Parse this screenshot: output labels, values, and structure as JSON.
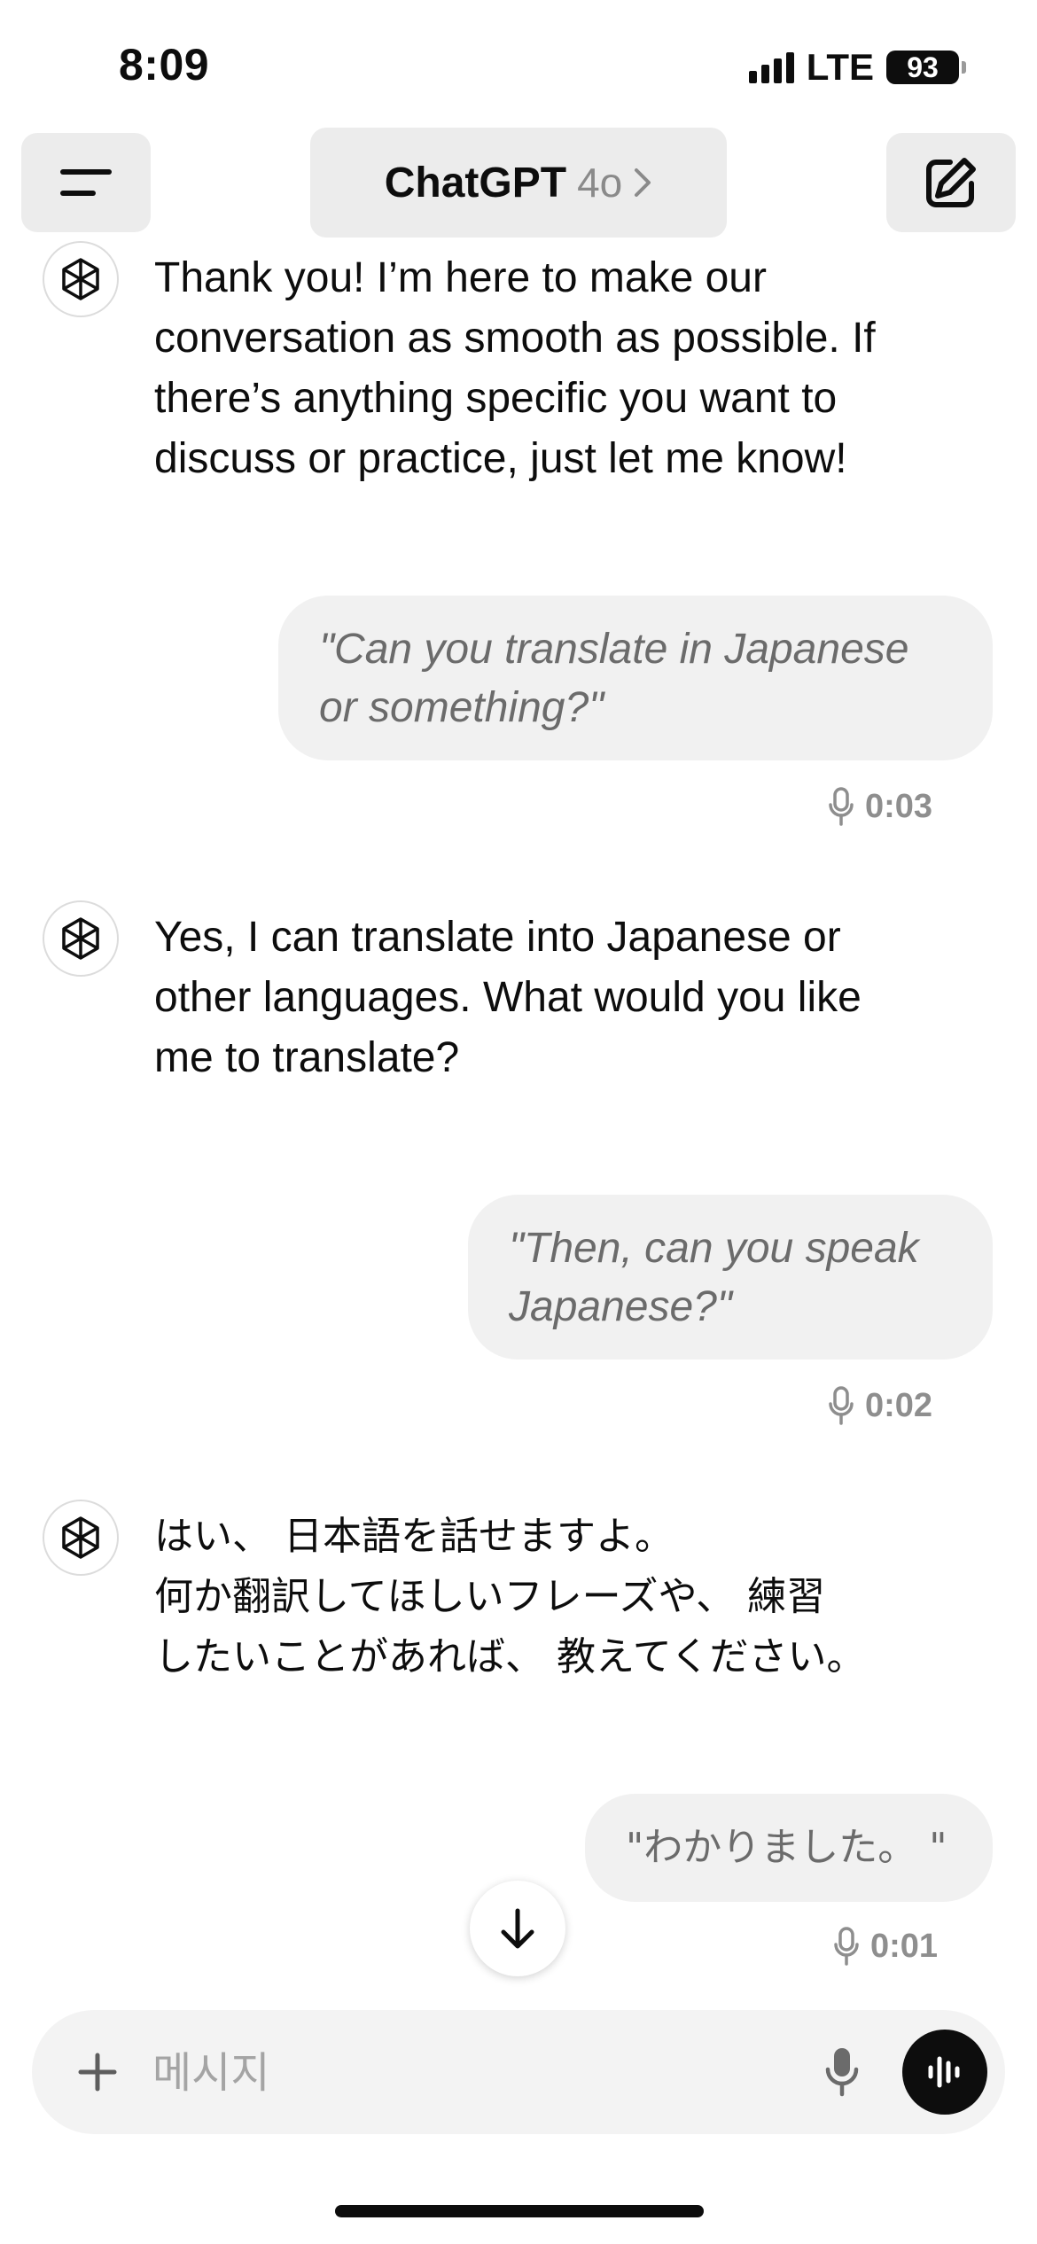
{
  "status_bar": {
    "time": "8:09",
    "network": "LTE",
    "battery": "93"
  },
  "header": {
    "title": "ChatGPT",
    "model": "4o",
    "icons": {
      "menu": "menu-icon",
      "compose": "new-chat-icon",
      "chevron": "chevron-right-icon"
    }
  },
  "messages": [
    {
      "role": "assistant",
      "text": "Thank you! I’m here to make our\nconversation as smooth as possible. If\nthere’s anything specific you want to\ndiscuss or practice, just let me know!"
    },
    {
      "role": "user",
      "text": "\"Can you translate in Japanese\nor something?\"",
      "duration": "0:03"
    },
    {
      "role": "assistant",
      "text": "Yes, I can translate into Japanese or\nother languages. What would you like\nme to translate?"
    },
    {
      "role": "user",
      "text": "\"Then, can you speak\nJapanese?\"",
      "duration": "0:02"
    },
    {
      "role": "assistant",
      "text": "はい、 日本語を話せますよ。\n何か翻訳してほしいフレーズや、 練習\nしたいことがあれば、 教えてください。"
    },
    {
      "role": "user",
      "text": "\"わかりました。 \"",
      "duration": "0:01"
    }
  ],
  "composer": {
    "placeholder": "메시지",
    "icons": {
      "add": "plus-icon",
      "dictate": "microphone-icon",
      "voice_mode": "voice-waveform-icon"
    }
  }
}
